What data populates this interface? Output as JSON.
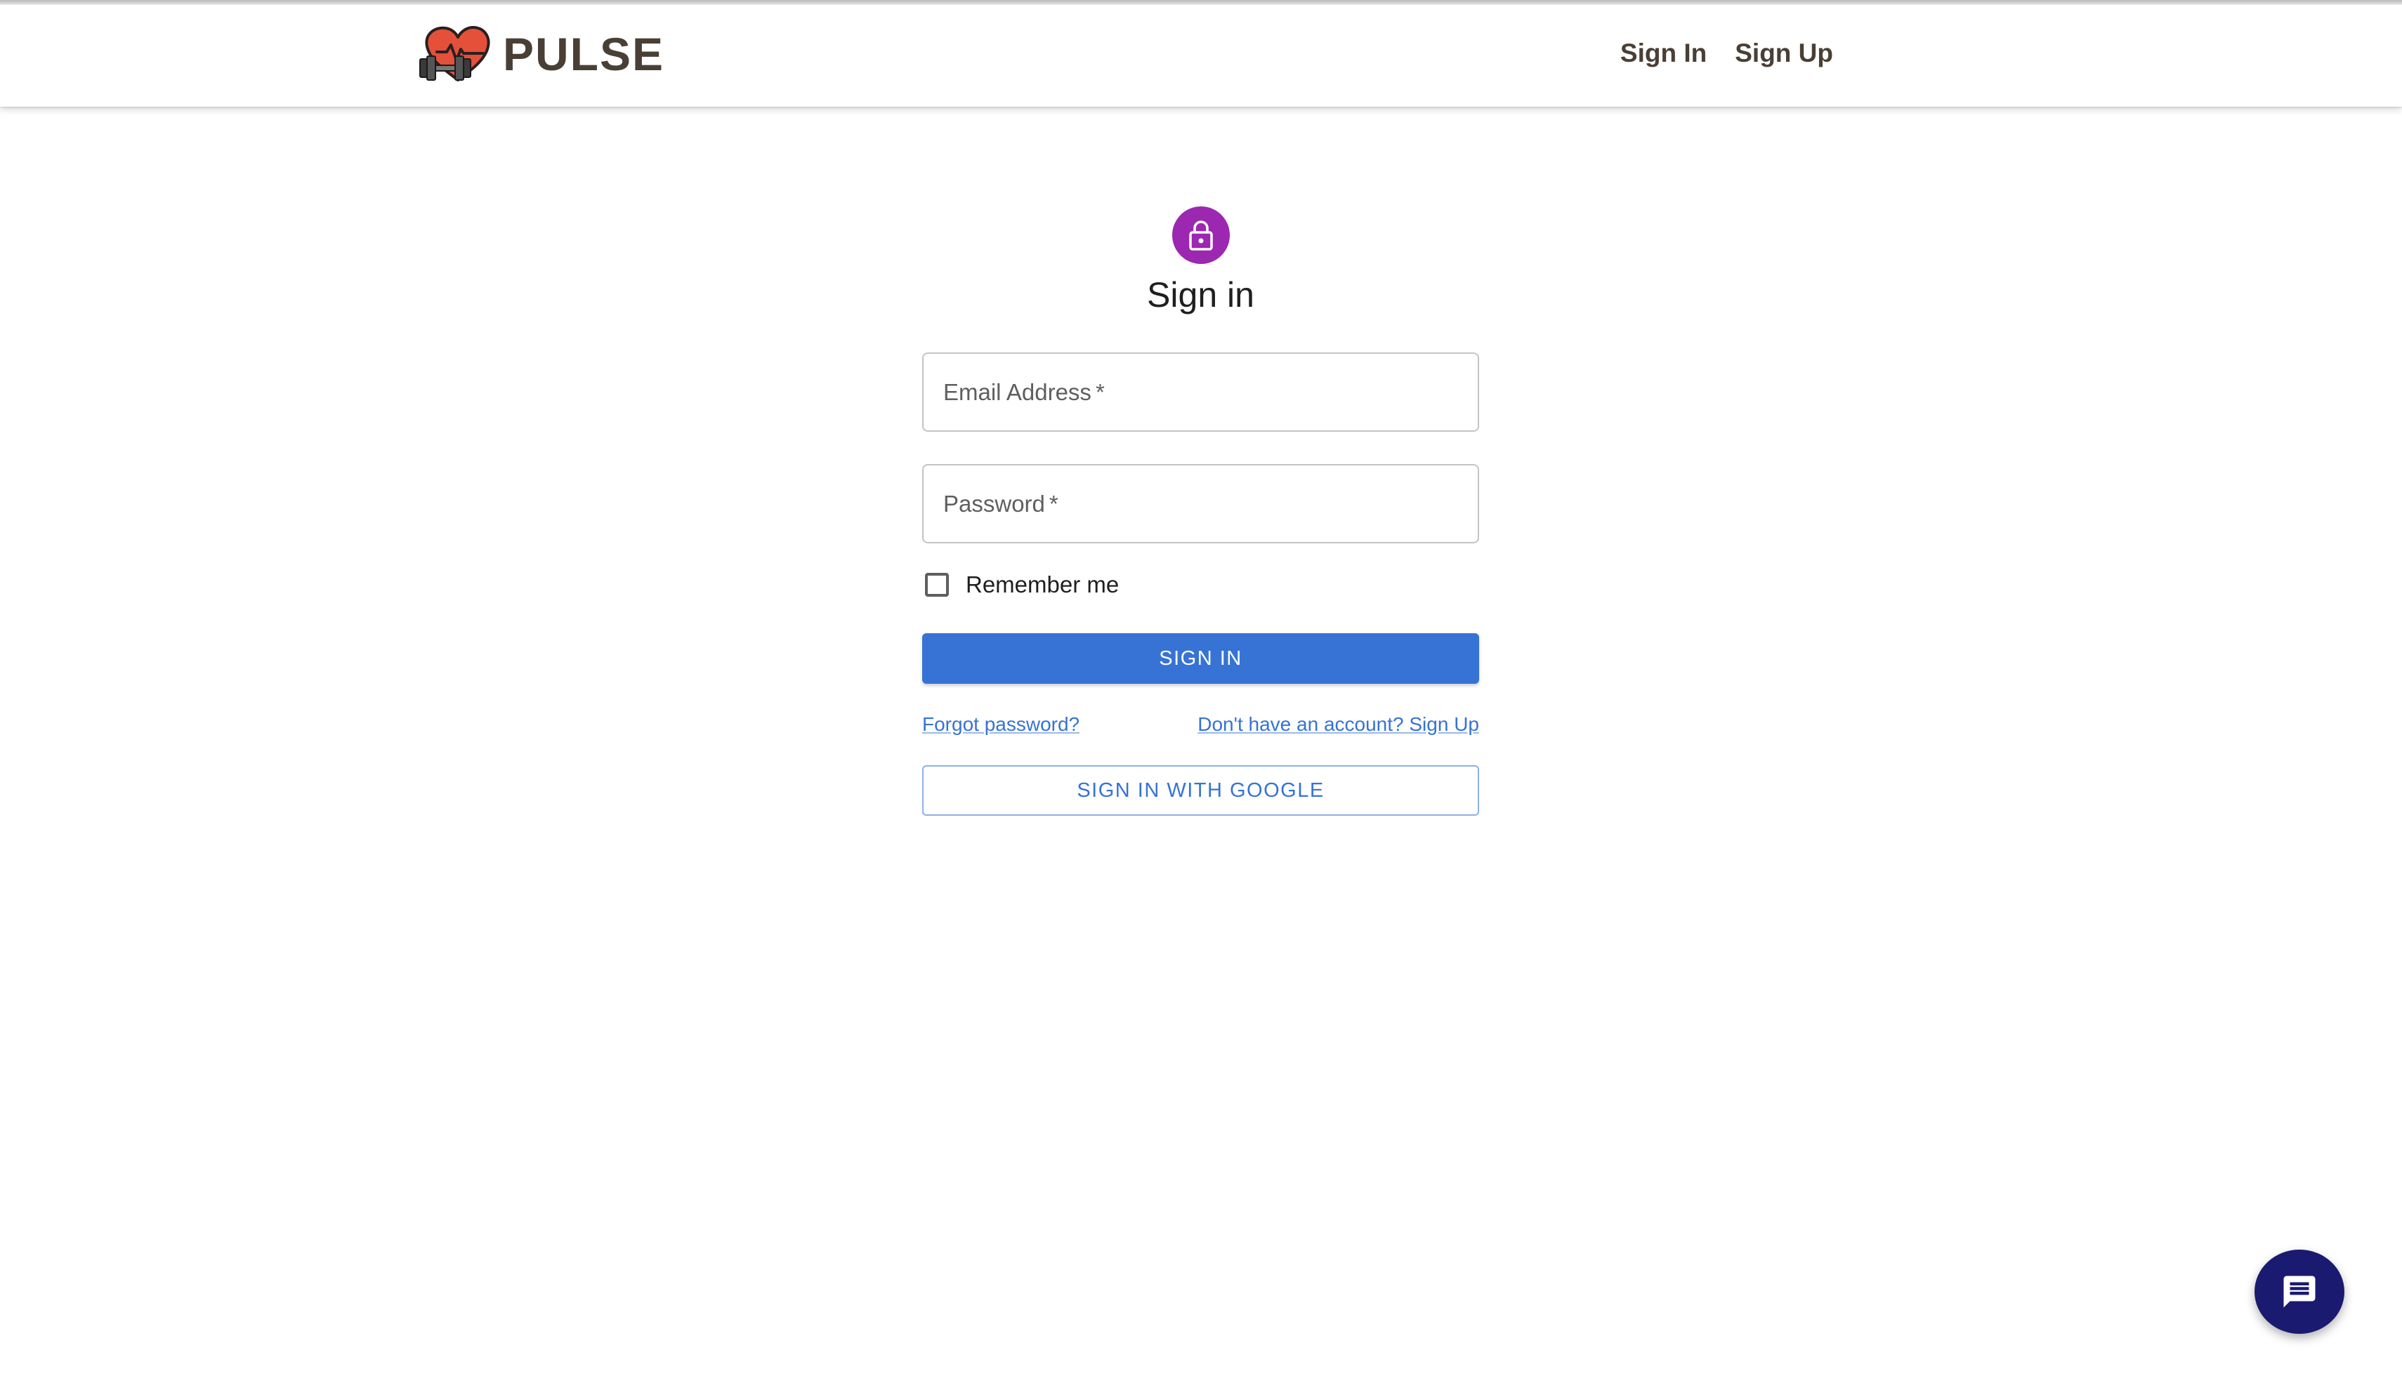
{
  "brand": {
    "name": "PULSE",
    "logo_icon": "heart-dumbbell-icon"
  },
  "nav": {
    "sign_in": "Sign In",
    "sign_up": "Sign Up"
  },
  "form": {
    "avatar_icon": "lock-icon",
    "title": "Sign in",
    "email": {
      "label": "Email Address",
      "required_mark": "*",
      "value": ""
    },
    "password": {
      "label": "Password",
      "required_mark": "*",
      "value": ""
    },
    "remember_label": "Remember me",
    "remember_checked": false,
    "submit_label": "SIGN IN",
    "forgot_link": "Forgot password?",
    "signup_link": "Don't have an account? Sign Up",
    "google_label": "SIGN IN WITH GOOGLE"
  },
  "chat": {
    "icon": "chat-icon"
  },
  "colors": {
    "primary": "#3673d4",
    "avatar": "#9c27b0",
    "brand_text": "#4a3f35",
    "chat_fab": "#1a1a70"
  }
}
